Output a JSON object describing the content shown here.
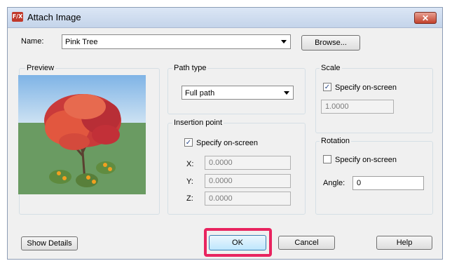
{
  "window": {
    "title": "Attach Image",
    "app_icon": "F/X",
    "close_glyph": "✕"
  },
  "name_field": {
    "label": "Name:",
    "value": "Pink Tree"
  },
  "browse_button": "Browse...",
  "preview": {
    "label": "Preview"
  },
  "path_type": {
    "label": "Path type",
    "value": "Full path"
  },
  "insertion_point": {
    "label": "Insertion point",
    "specify_label": "Specify on-screen",
    "x_label": "X:",
    "x_value": "0.0000",
    "y_label": "Y:",
    "y_value": "0.0000",
    "z_label": "Z:",
    "z_value": "0.0000"
  },
  "scale": {
    "label": "Scale",
    "specify_label": "Specify on-screen",
    "value": "1.0000"
  },
  "rotation": {
    "label": "Rotation",
    "specify_label": "Specify on-screen",
    "angle_label": "Angle:",
    "angle_value": "0"
  },
  "buttons": {
    "show_details": "Show Details",
    "ok": "OK",
    "cancel": "Cancel",
    "help": "Help"
  },
  "colors": {
    "highlight": "#e8245f",
    "close": "#c2412c"
  }
}
